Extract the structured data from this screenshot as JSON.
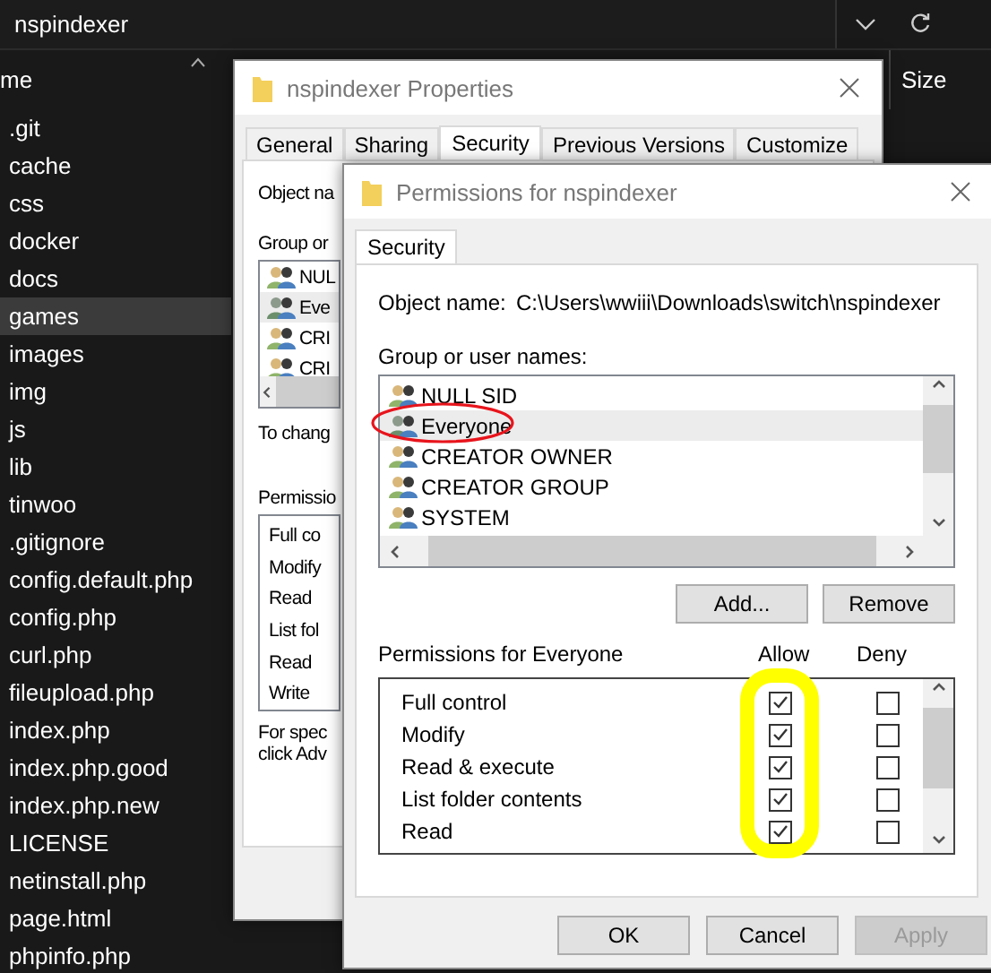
{
  "explorer": {
    "address": "nspindexer",
    "column_header": "me",
    "size_header": "Size",
    "files": [
      {
        "name": ".git",
        "selected": false
      },
      {
        "name": "cache",
        "selected": false
      },
      {
        "name": "css",
        "selected": false
      },
      {
        "name": "docker",
        "selected": false
      },
      {
        "name": "docs",
        "selected": false
      },
      {
        "name": "games",
        "selected": true
      },
      {
        "name": "images",
        "selected": false
      },
      {
        "name": "img",
        "selected": false
      },
      {
        "name": "js",
        "selected": false
      },
      {
        "name": "lib",
        "selected": false
      },
      {
        "name": "tinwoo",
        "selected": false
      },
      {
        "name": ".gitignore",
        "selected": false
      },
      {
        "name": "config.default.php",
        "selected": false
      },
      {
        "name": "config.php",
        "selected": false
      },
      {
        "name": "curl.php",
        "selected": false
      },
      {
        "name": "fileupload.php",
        "selected": false
      },
      {
        "name": "index.php",
        "selected": false
      },
      {
        "name": "index.php.good",
        "selected": false
      },
      {
        "name": "index.php.new",
        "selected": false
      },
      {
        "name": "LICENSE",
        "selected": false
      },
      {
        "name": "netinstall.php",
        "selected": false
      },
      {
        "name": "page.html",
        "selected": false
      },
      {
        "name": "phpinfo.php",
        "selected": false
      }
    ]
  },
  "properties": {
    "title": "nspindexer Properties",
    "tabs": [
      {
        "label": "General",
        "selected": false
      },
      {
        "label": "Sharing",
        "selected": false
      },
      {
        "label": "Security",
        "selected": true
      },
      {
        "label": "Previous Versions",
        "selected": false
      },
      {
        "label": "Customize",
        "selected": false
      }
    ],
    "object_label": "Object na",
    "group_label": "Group or",
    "users": [
      {
        "name": "NUL",
        "selected": false
      },
      {
        "name": "Eve",
        "selected": true
      },
      {
        "name": "CRI",
        "selected": false
      },
      {
        "name": "CRI",
        "selected": false
      }
    ],
    "change_note": "To chang",
    "permissions_label": "Permissio",
    "permissions": [
      "Full co",
      "Modify",
      "Read",
      "List fol",
      "Read",
      "Write"
    ],
    "footer": [
      "For spec",
      "click Adv"
    ]
  },
  "permissions_dialog": {
    "title": "Permissions for nspindexer",
    "tabs": [
      {
        "label": "Security",
        "selected": true
      }
    ],
    "object_label": "Object name:",
    "object_path": "C:\\Users\\wwiii\\Downloads\\switch\\nspindexer",
    "group_label": "Group or user names:",
    "users": [
      {
        "name": "NULL SID",
        "selected": false
      },
      {
        "name": "Everyone",
        "selected": true
      },
      {
        "name": "CREATOR OWNER",
        "selected": false
      },
      {
        "name": "CREATOR GROUP",
        "selected": false
      },
      {
        "name": "SYSTEM",
        "selected": false
      }
    ],
    "list_buttons": [
      "Add...",
      "Remove"
    ],
    "permissions_label": "Permissions for Everyone",
    "allow_header": "Allow",
    "deny_header": "Deny",
    "permissions": [
      {
        "name": "Full control",
        "allow": true,
        "deny": false
      },
      {
        "name": "Modify",
        "allow": true,
        "deny": false
      },
      {
        "name": "Read & execute",
        "allow": true,
        "deny": false
      },
      {
        "name": "List folder contents",
        "allow": true,
        "deny": false
      },
      {
        "name": "Read",
        "allow": true,
        "deny": false
      }
    ],
    "buttons": [
      {
        "label": "OK",
        "disabled": false
      },
      {
        "label": "Cancel",
        "disabled": false
      },
      {
        "label": "Apply",
        "disabled": true
      }
    ]
  },
  "annotations": [
    {
      "kind": "circle",
      "color": "#e8141c"
    },
    {
      "kind": "highlight",
      "color": "#ffff00"
    }
  ]
}
